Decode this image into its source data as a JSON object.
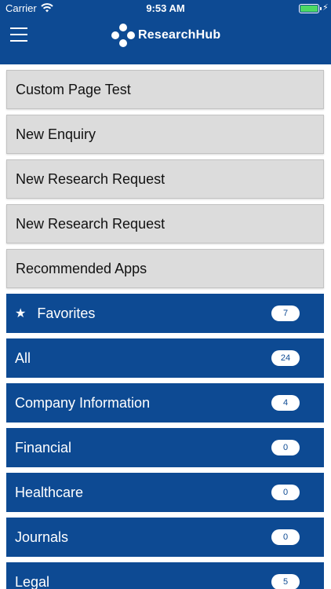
{
  "status": {
    "carrier": "Carrier",
    "time": "9:53 AM",
    "battery_level": 1.0
  },
  "app": {
    "title": "ResearchHub",
    "menu_icon": "hamburger-menu-icon"
  },
  "colors": {
    "brand": "#0d4a93",
    "gray_row": "#dcdcdc",
    "battery": "#4cd964"
  },
  "pages": [
    {
      "label": "Custom Page Test"
    },
    {
      "label": "New Enquiry"
    },
    {
      "label": "New Research Request"
    },
    {
      "label": "New Research Request"
    },
    {
      "label": "Recommended Apps"
    }
  ],
  "categories": [
    {
      "label": "Favorites",
      "count": "7",
      "icon": "star-icon"
    },
    {
      "label": "All",
      "count": "24"
    },
    {
      "label": "Company Information",
      "count": "4"
    },
    {
      "label": "Financial",
      "count": "0"
    },
    {
      "label": "Healthcare",
      "count": "0"
    },
    {
      "label": "Journals",
      "count": "0"
    },
    {
      "label": "Legal",
      "count": "5"
    }
  ]
}
